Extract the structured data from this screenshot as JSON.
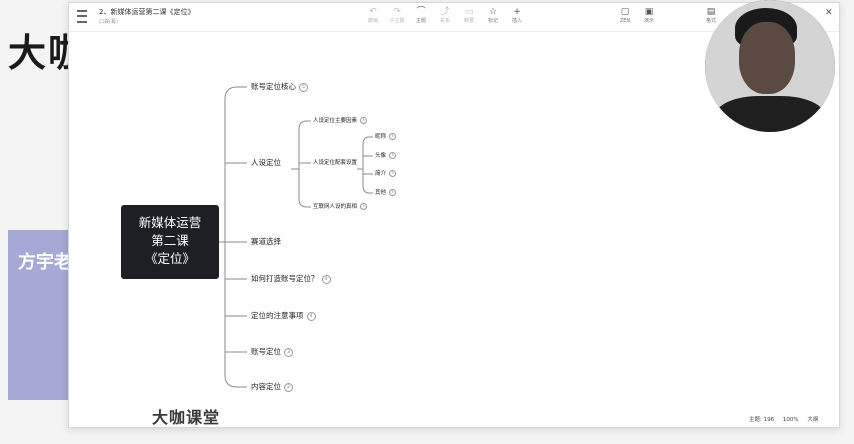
{
  "background": {
    "title": "大咖",
    "band_text": "方宇老"
  },
  "window": {
    "title": "2、新媒体运营第二课《定位》",
    "subtitle": "口袋(幕)",
    "toolbar_left": [
      {
        "icon": "undo-icon",
        "label": "撤销"
      },
      {
        "icon": "redo-icon",
        "label": "子主题"
      },
      {
        "icon": "summary-icon",
        "label": "主题"
      },
      {
        "icon": "relation-icon",
        "label": "关系"
      },
      {
        "icon": "outline-icon",
        "label": "概要"
      },
      {
        "icon": "star-icon",
        "label": "标记"
      },
      {
        "icon": "insert-icon",
        "label": "插入"
      }
    ],
    "toolbar_right": [
      {
        "icon": "zen-icon",
        "label": "ZEN"
      },
      {
        "icon": "present-icon",
        "label": "演示"
      },
      {
        "icon": "format-icon",
        "label": "格式"
      }
    ]
  },
  "mindmap": {
    "central": [
      "新媒体运营",
      "第二课",
      "《定位》"
    ],
    "branches": [
      {
        "label": "账号定位核心",
        "badge": "5"
      },
      {
        "label": "人设定位",
        "badge": ""
      },
      {
        "label": "赛道选择",
        "badge": ""
      },
      {
        "label": "如何打造账号定位？",
        "badge": "4"
      },
      {
        "label": "定位的注意事项",
        "badge": "4"
      },
      {
        "label": "账号定位",
        "badge": "3"
      },
      {
        "label": "内容定位",
        "badge": "2"
      }
    ],
    "persona_children": [
      {
        "label": "人设定位主要因素",
        "badge": "3"
      },
      {
        "label": "人设定位配套设置",
        "badge": ""
      },
      {
        "label": "互联网人设的真相",
        "badge": "3"
      }
    ],
    "setup_children": [
      {
        "label": "昵称",
        "badge": "3"
      },
      {
        "label": "头像",
        "badge": "3"
      },
      {
        "label": "简介",
        "badge": "3"
      },
      {
        "label": "其他",
        "badge": "3"
      }
    ]
  },
  "status_bar": {
    "topics": "主题: 196",
    "zoom": "100%",
    "size": "大纲"
  },
  "watermark": "大咖课堂",
  "colors": {
    "central_bg": "#1e1f24",
    "line": "#8a8a8a",
    "band": "#a6a8d6"
  }
}
